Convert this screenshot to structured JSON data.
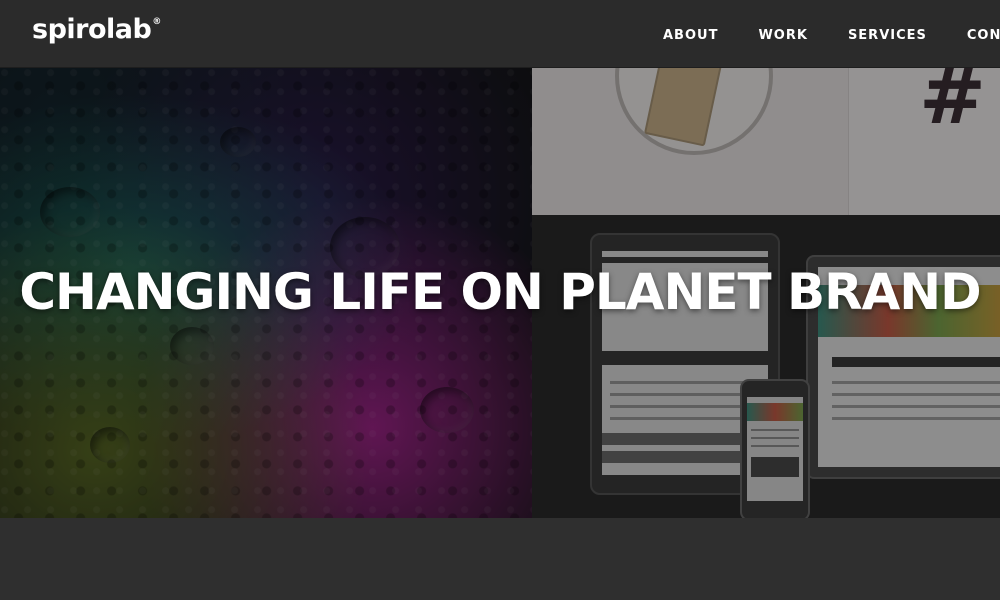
{
  "header": {
    "logo_text": "spirolab",
    "logo_mark": "®",
    "nav": [
      {
        "label": "ABOUT"
      },
      {
        "label": "WORK"
      },
      {
        "label": "SERVICES"
      },
      {
        "label": "CONTACT"
      }
    ]
  },
  "hero": {
    "headline": "CHANGING LIFE ON PLANET BRAND",
    "left_image": "moon-surface-colored-image",
    "right_images": [
      "product-photo",
      "responsive-devices-mockup"
    ]
  },
  "colors": {
    "header_bg": "#2b2b2b",
    "page_bg": "#2f2f2f",
    "text": "#ffffff"
  }
}
